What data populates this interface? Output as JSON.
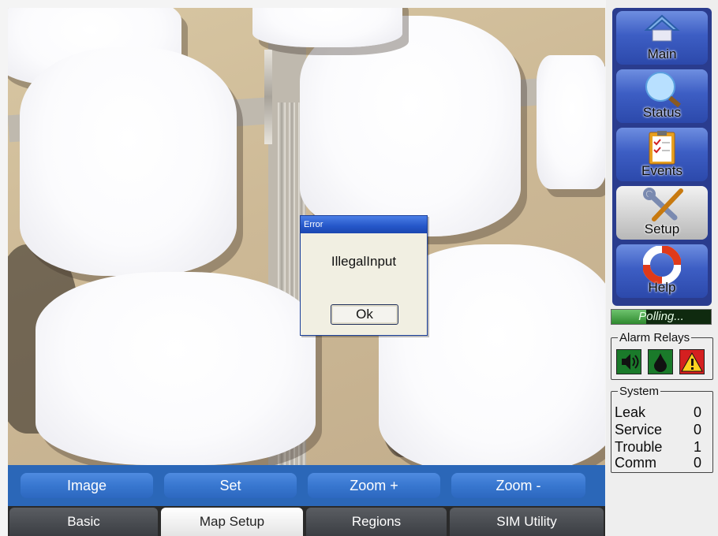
{
  "dialog": {
    "title": "Error",
    "message": "IllegalInput",
    "ok_label": "Ok"
  },
  "action_bar": {
    "buttons": [
      {
        "label": "Image"
      },
      {
        "label": "Set"
      },
      {
        "label": "Zoom +"
      },
      {
        "label": "Zoom -"
      }
    ]
  },
  "tabs": [
    {
      "label": "Basic",
      "active": false
    },
    {
      "label": "Map Setup",
      "active": true
    },
    {
      "label": "Regions",
      "active": false
    },
    {
      "label": "SIM Utility",
      "active": false
    }
  ],
  "nav": [
    {
      "label": "Main",
      "icon": "home-icon"
    },
    {
      "label": "Status",
      "icon": "magnifier-icon"
    },
    {
      "label": "Events",
      "icon": "clipboard-checklist-icon"
    },
    {
      "label": "Setup",
      "icon": "wrench-screwdriver-icon",
      "active": true
    },
    {
      "label": "Help",
      "icon": "lifebuoy-icon"
    }
  ],
  "polling": {
    "text": "Polling...",
    "progress": 0.35
  },
  "alarm_relays": {
    "title": "Alarm Relays",
    "relays": [
      {
        "icon": "speaker-icon",
        "color": "#1a7a2a"
      },
      {
        "icon": "drop-icon",
        "color": "#1a7a2a"
      },
      {
        "icon": "warning-icon",
        "color": "#d42020"
      }
    ]
  },
  "system": {
    "title": "System",
    "rows": [
      {
        "label": "Leak",
        "value": "0"
      },
      {
        "label": "Service",
        "value": "0"
      },
      {
        "label": "Trouble",
        "value": "1"
      },
      {
        "label": "Comm",
        "value": "0"
      }
    ]
  },
  "colors": {
    "action_bar": "#2b67b8",
    "nav_panel": "#2a3c8e",
    "title_bar": "#2456c8"
  }
}
